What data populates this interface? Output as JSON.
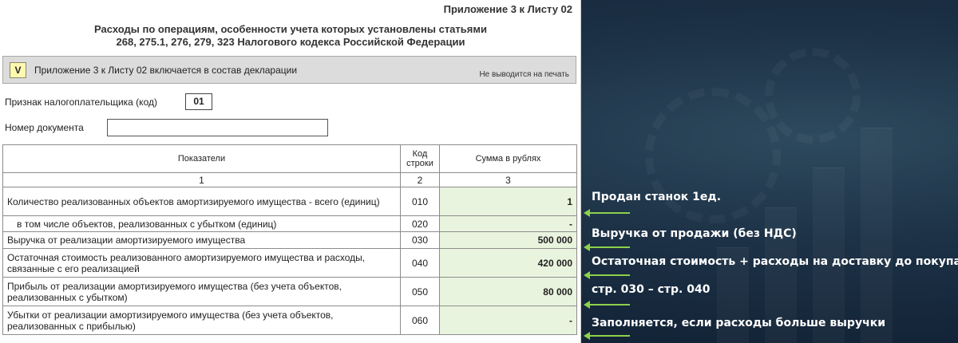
{
  "doc": {
    "appendix_title": "Приложение 3 к Листу 02",
    "title_line1": "Расходы по операциям, особенности учета которых установлены статьями",
    "title_line2": "268, 275.1, 276, 279, 323 Налогового кодекса Российской Федерации",
    "include_checkbox": "V",
    "include_text": "Приложение 3 к Листу 02 включается в состав декларации",
    "no_print_note": "Не выводится на печать",
    "taxpayer_sign_label": "Признак налогоплательщика (код)",
    "taxpayer_sign_value": "01",
    "doc_number_label": "Номер документа",
    "doc_number_value": ""
  },
  "table": {
    "headers": {
      "indicators": "Показатели",
      "code_line1": "Код",
      "code_line2": "строки",
      "amount": "Сумма в рублях"
    },
    "col_numbers": [
      "1",
      "2",
      "3"
    ],
    "rows": [
      {
        "label": "Количество реализованных объектов амортизируемого имущества - всего (единиц)",
        "code": "010",
        "value": "1"
      },
      {
        "label": "в том числе объектов, реализованных с убытком (единиц)",
        "code": "020",
        "value": "-"
      },
      {
        "label": "Выручка от реализации амортизируемого имущества",
        "code": "030",
        "value": "500 000"
      },
      {
        "label": "Остаточная стоимость реализованного амортизируемого имущества и расходы, связанные с его реализацией",
        "code": "040",
        "value": "420 000"
      },
      {
        "label": "Прибыль от реализации амортизируемого имущества (без учета объектов, реализованных с убытком)",
        "code": "050",
        "value": "80 000"
      },
      {
        "label": "Убытки от реализации амортизируемого имущества (без учета объектов, реализованных с прибылью)",
        "code": "060",
        "value": "-"
      }
    ]
  },
  "annotations": [
    "Продан станок 1ед.",
    "Выручка от продажи (без НДС)",
    "Остаточная стоимость + расходы на доставку до покупателя",
    "стр. 030 – стр. 040",
    "Заполняется, если расходы больше выручки"
  ],
  "colors": {
    "arrow": "#8ed04b",
    "value_cell": "#e9f4de",
    "background": "#1d3247"
  }
}
